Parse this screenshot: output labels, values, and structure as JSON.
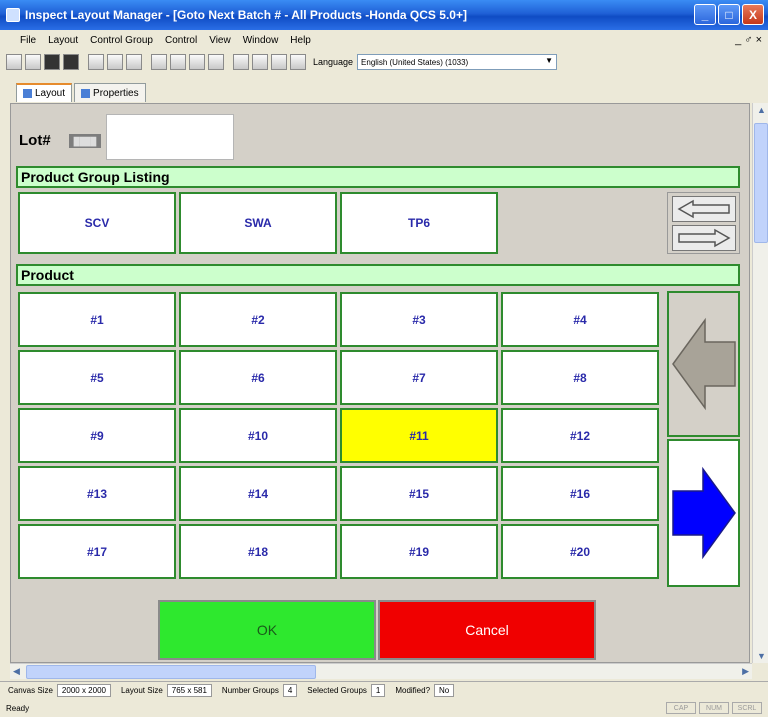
{
  "window": {
    "title": "Inspect Layout Manager - [Goto Next Batch # - All Products -Honda QCS 5.0+]",
    "controls": {
      "minimize": "_",
      "maximize": "□",
      "close": "X"
    }
  },
  "menu": {
    "items": [
      "File",
      "Layout",
      "Control Group",
      "Control",
      "View",
      "Window",
      "Help"
    ],
    "mdi_controls": "_ ♂ ×"
  },
  "toolbar": {
    "language_label": "Language",
    "language_value": "English (United States) (1033)"
  },
  "tabs": [
    {
      "label": "Layout",
      "active": true
    },
    {
      "label": "Properties",
      "active": false
    }
  ],
  "lot": {
    "label": "Lot#",
    "badge": "████",
    "value": ""
  },
  "product_group_listing": {
    "header": "Product Group Listing",
    "groups": [
      "SCV",
      "SWA",
      "TP6"
    ]
  },
  "product": {
    "header": "Product",
    "items": [
      "#1",
      "#2",
      "#3",
      "#4",
      "#5",
      "#6",
      "#7",
      "#8",
      "#9",
      "#10",
      "#11",
      "#12",
      "#13",
      "#14",
      "#15",
      "#16",
      "#17",
      "#18",
      "#19",
      "#20"
    ],
    "selected": "#11",
    "selected_color": "#ffff00",
    "prev_arrow_color": "#a8a398",
    "next_arrow_color": "#0000ff"
  },
  "actions": {
    "ok": "OK",
    "cancel": "Cancel"
  },
  "status": {
    "canvas_size_label": "Canvas Size",
    "canvas_size_value": "2000 x 2000",
    "layout_size_label": "Layout Size",
    "layout_size_value": "765 x 581",
    "number_groups_label": "Number Groups",
    "number_groups_value": "4",
    "selected_groups_label": "Selected Groups",
    "selected_groups_value": "1",
    "modified_label": "Modified?",
    "modified_value": "No",
    "ready": "Ready",
    "indicators": [
      "CAP",
      "NUM",
      "SCRL"
    ]
  }
}
